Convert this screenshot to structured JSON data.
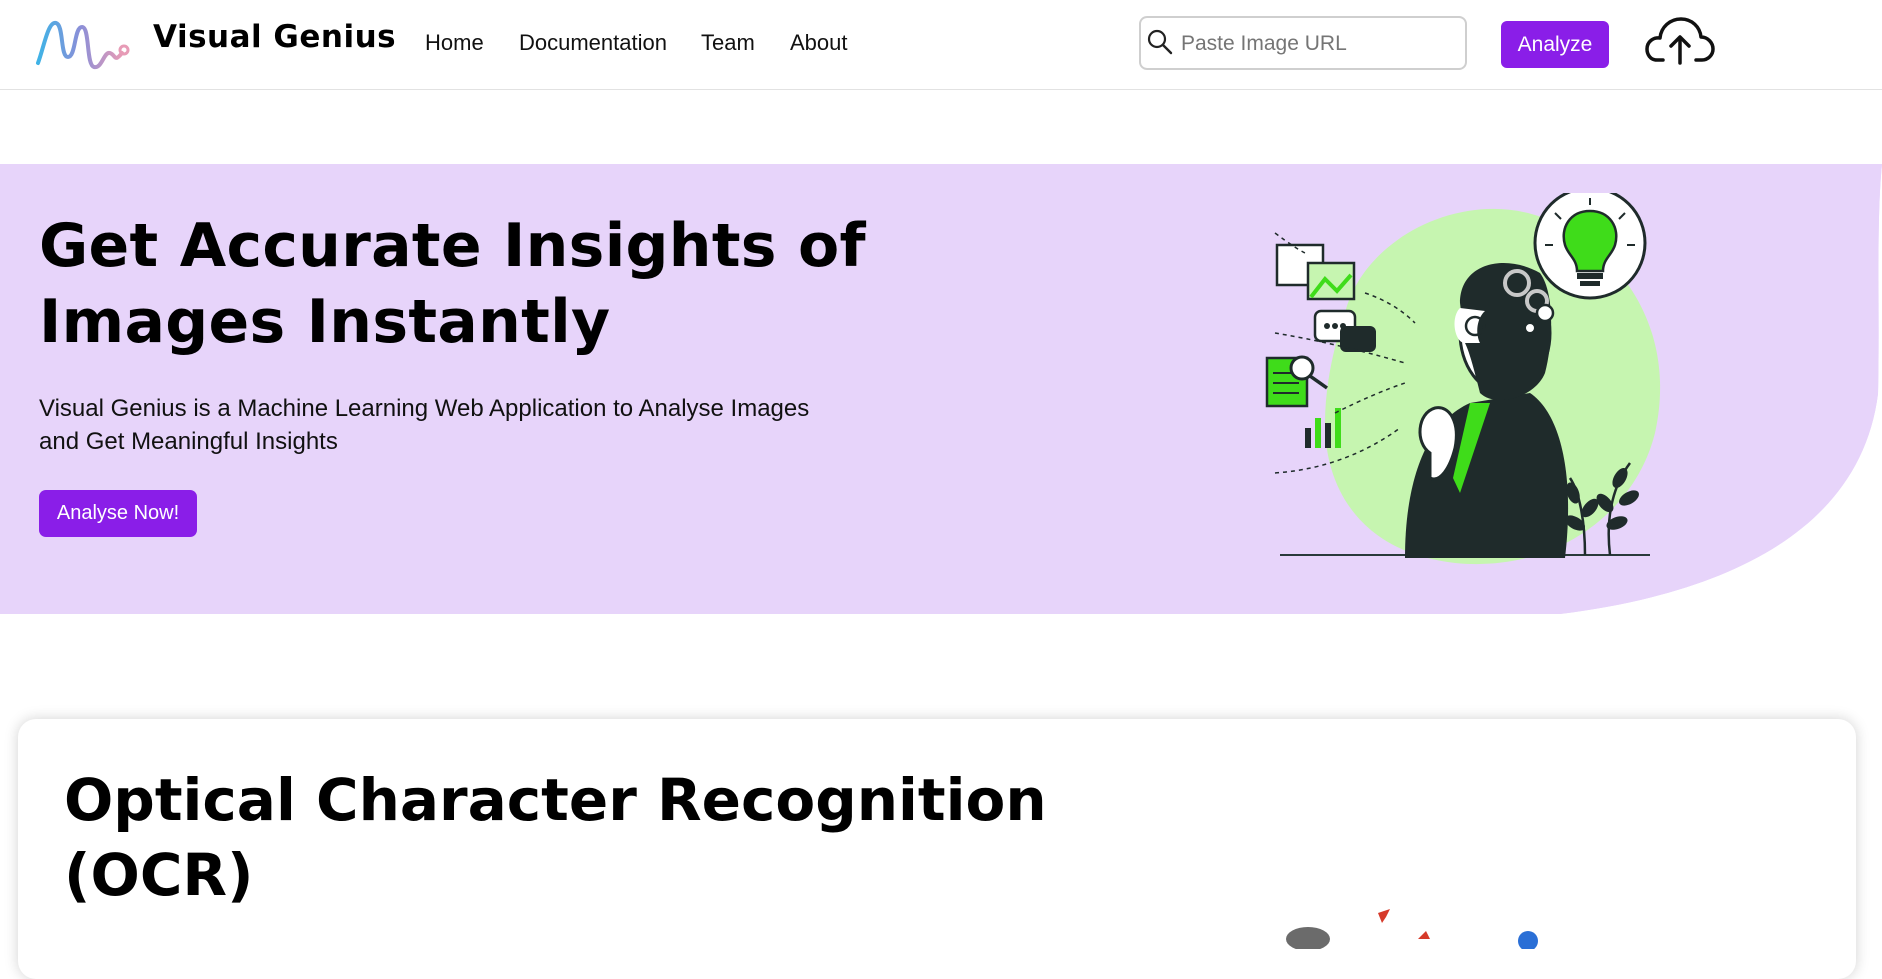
{
  "header": {
    "brand": "Visual Genius",
    "nav": [
      {
        "label": "Home"
      },
      {
        "label": "Documentation"
      },
      {
        "label": "Team"
      },
      {
        "label": "About"
      }
    ],
    "search": {
      "placeholder": "Paste Image URL",
      "value": ""
    },
    "analyze_label": "Analyze",
    "icons": {
      "search": "search-icon",
      "upload": "cloud-upload-icon",
      "logo": "visual-genius-logo"
    }
  },
  "hero": {
    "title_line1": "Get Accurate Insights of",
    "title_line2": "Images Instantly",
    "description_line1": "Visual Genius is a Machine Learning Web Application to Analyse Images",
    "description_line2": "and Get Meaningful Insights",
    "cta_label": "Analyse Now!"
  },
  "feature_card": {
    "title_line1": "Optical Character Recognition",
    "title_line2": "(OCR)"
  },
  "colors": {
    "accent": "#8a1ee8",
    "hero_bg": "#e7d4fa",
    "illustration_green": "#3fdc1a",
    "blob_green": "#c6f5b0"
  }
}
